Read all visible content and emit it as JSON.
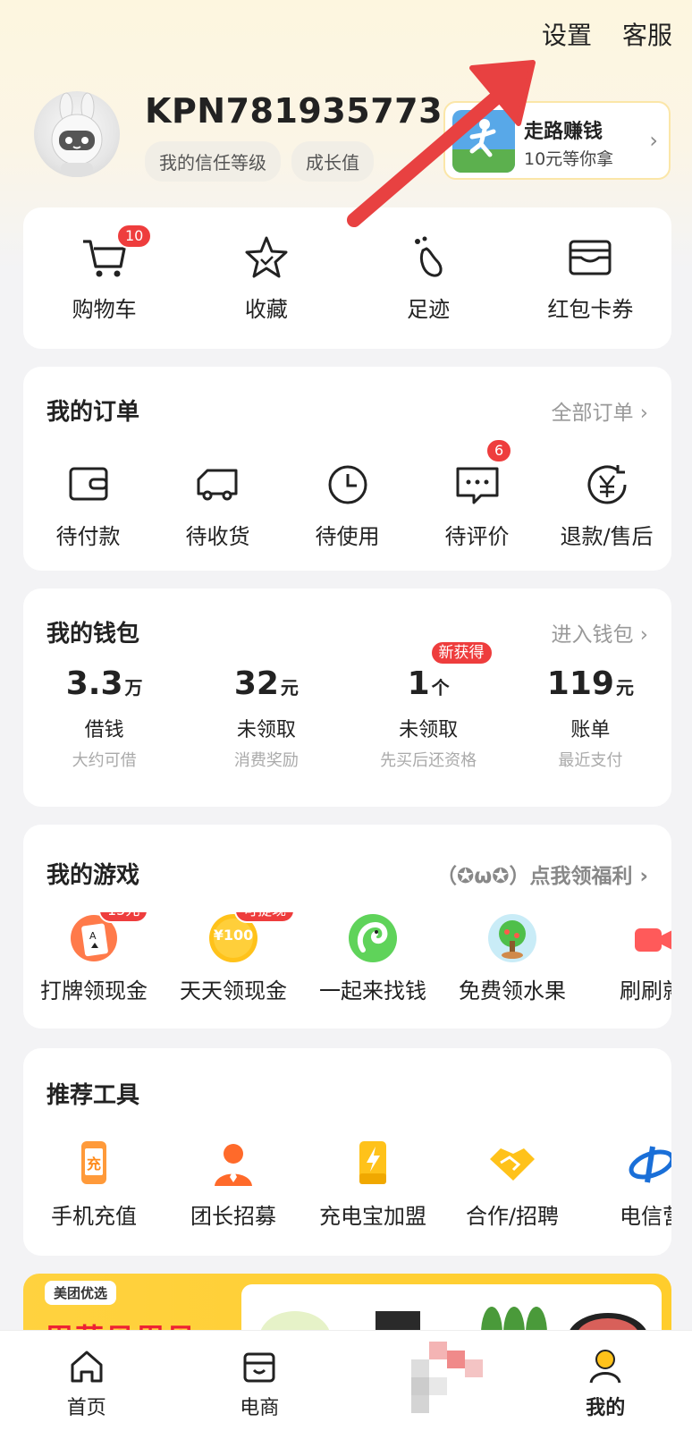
{
  "header": {
    "settings_label": "设置",
    "service_label": "客服"
  },
  "profile": {
    "username": "KPN781935773",
    "chips": [
      "我的信任等级",
      "成长值"
    ]
  },
  "walk_promo": {
    "title": "走路赚钱",
    "subtitle": "10元等你拿"
  },
  "shortcuts": [
    {
      "label": "购物车",
      "icon": "cart-icon",
      "badge": "10"
    },
    {
      "label": "收藏",
      "icon": "star-icon"
    },
    {
      "label": "足迹",
      "icon": "footprint-icon"
    },
    {
      "label": "红包卡券",
      "icon": "wallet-card-icon"
    }
  ],
  "orders": {
    "title": "我的订单",
    "link": "全部订单 ›",
    "items": [
      {
        "label": "待付款",
        "icon": "wallet-icon"
      },
      {
        "label": "待收货",
        "icon": "truck-icon"
      },
      {
        "label": "待使用",
        "icon": "clock-icon"
      },
      {
        "label": "待评价",
        "icon": "comment-icon",
        "badge": "6"
      },
      {
        "label": "退款/售后",
        "icon": "refund-icon"
      }
    ]
  },
  "wallet": {
    "title": "我的钱包",
    "link": "进入钱包 ›",
    "items": [
      {
        "num": "3.3",
        "unit": "万",
        "label": "借钱",
        "sub": "大约可借"
      },
      {
        "num": "32",
        "unit": "元",
        "label": "未领取",
        "sub": "消费奖励"
      },
      {
        "num": "1",
        "unit": "个",
        "label": "未领取",
        "sub": "先买后还资格",
        "badge": "新获得"
      },
      {
        "num": "119",
        "unit": "元",
        "label": "账单",
        "sub": "最近支付"
      }
    ]
  },
  "games": {
    "title": "我的游戏",
    "link": "（✪ω✪）点我领福利 ›",
    "items": [
      {
        "label": "打牌领现金",
        "badge": "15元"
      },
      {
        "label": "天天领现金",
        "badge": "可提现",
        "icon_text": "¥100"
      },
      {
        "label": "一起来找钱"
      },
      {
        "label": "免费领水果"
      },
      {
        "label": "刷刷就"
      }
    ]
  },
  "tools": {
    "title": "推荐工具",
    "items": [
      {
        "label": "手机充值",
        "icon_text": "充"
      },
      {
        "label": "团长招募"
      },
      {
        "label": "充电宝加盟"
      },
      {
        "label": "合作/招聘"
      },
      {
        "label": "电信营"
      }
    ]
  },
  "banner": {
    "tag": "美团优选",
    "slogan": "周菜贝周贝"
  },
  "bottom_nav": [
    {
      "label": "首页",
      "icon": "home-icon"
    },
    {
      "label": "电商",
      "icon": "shop-box-icon"
    },
    {
      "label": "",
      "icon": "center-icon"
    },
    {
      "label": "我的",
      "icon": "profile-icon",
      "active": true
    }
  ],
  "colors": {
    "accent_yellow": "#ffd23f",
    "badge_red": "#ee3d3d",
    "arrow_red": "#e84141"
  }
}
